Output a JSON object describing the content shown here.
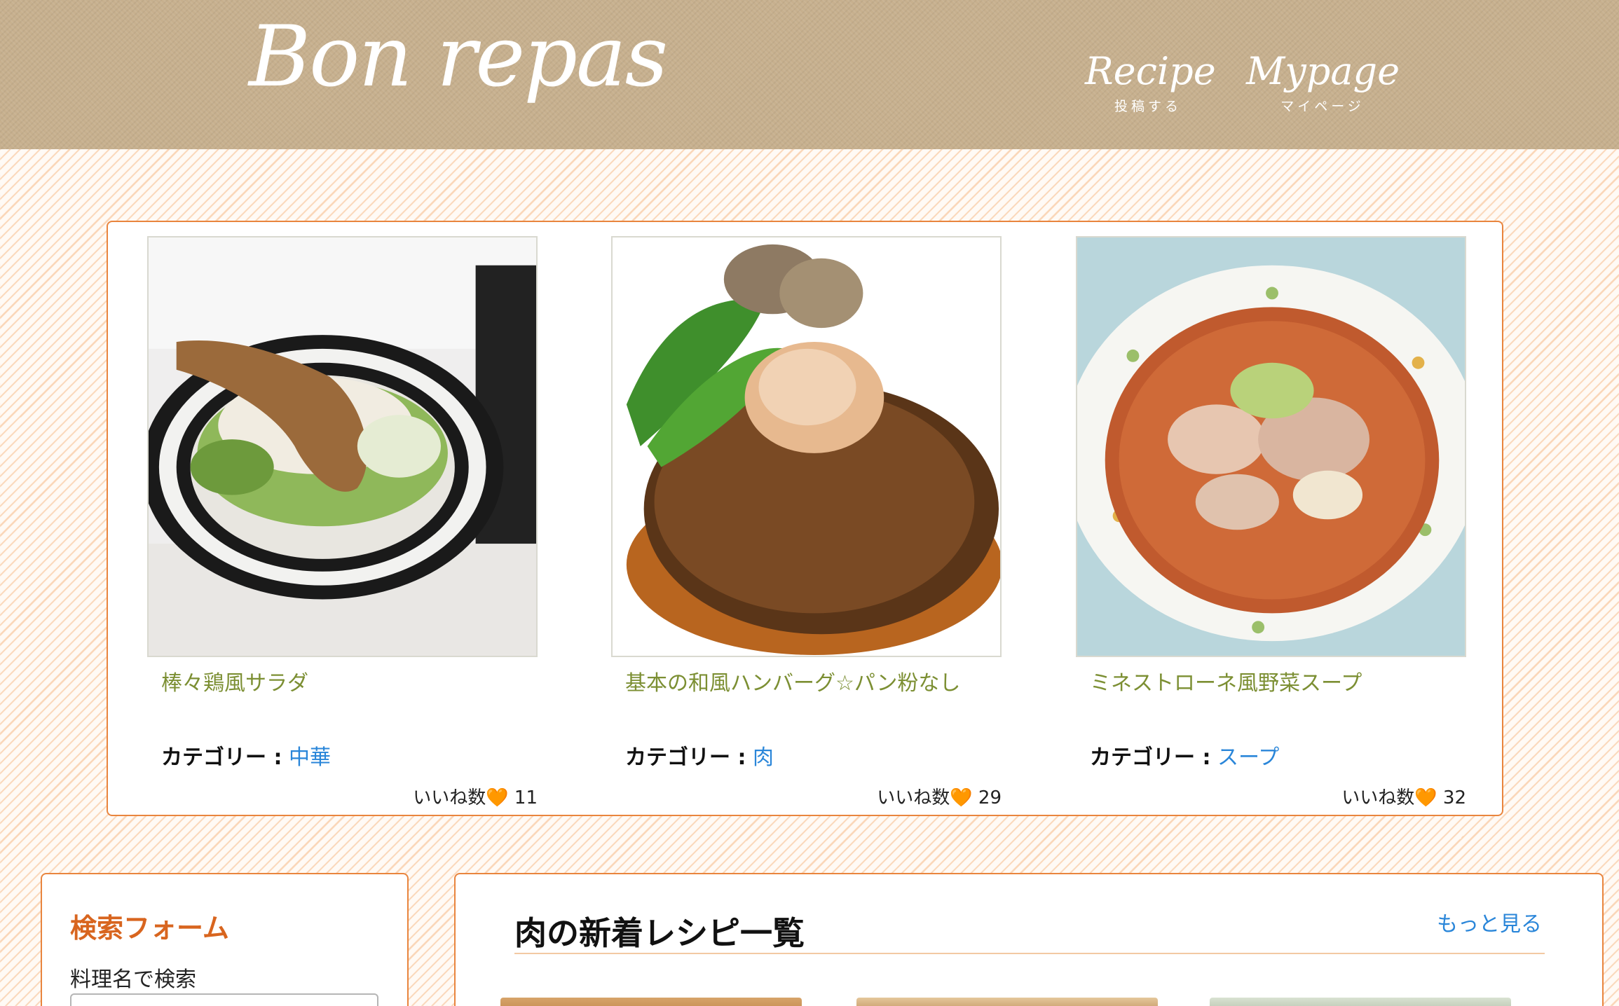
{
  "header": {
    "logo": "Bon repas",
    "nav": [
      {
        "title": "Recipe",
        "sub": "投稿する"
      },
      {
        "title": "Mypage",
        "sub": "マイページ"
      }
    ]
  },
  "featured": [
    {
      "title": "棒々鶏風サラダ",
      "category_label": "カテゴリー :",
      "category": "中華",
      "likes_label": "いいね数",
      "likes": "11",
      "image": "bang-bang-chicken-salad"
    },
    {
      "title": "基本の和風ハンバーグ☆パン粉なし",
      "category_label": "カテゴリー :",
      "category": "肉",
      "likes_label": "いいね数",
      "likes": "29",
      "image": "japanese-hamburg-steak"
    },
    {
      "title": "ミネストローネ風野菜スープ",
      "category_label": "カテゴリー :",
      "category": "スープ",
      "likes_label": "いいね数",
      "likes": "32",
      "image": "minestrone-vegetable-soup"
    }
  ],
  "heart_icon": "🧡",
  "search": {
    "title": "検索フォーム",
    "label": "料理名で検索",
    "value": "",
    "placeholder": ""
  },
  "recent": {
    "title": "肉の新着レシピ一覧",
    "more": "もっと見る"
  },
  "colors": {
    "accent_orange": "#e9853e",
    "title_green": "#7c8f33",
    "link_blue": "#2a86d9",
    "header_tan": "#c7b08e"
  }
}
